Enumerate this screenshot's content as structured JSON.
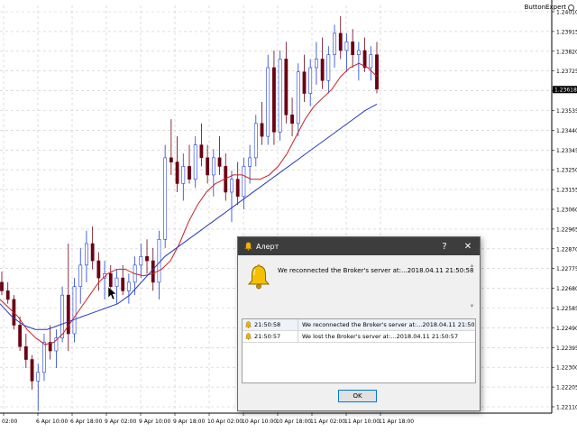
{
  "expert": {
    "label": "ButtonExpert"
  },
  "chart_data": {
    "type": "candlestick",
    "yticks": [
      "1.24010",
      "1.23915",
      "1.23820",
      "1.23725",
      "1.23630",
      "1.23535",
      "1.23440",
      "1.23345",
      "1.23250",
      "1.23155",
      "1.23060",
      "1.22965",
      "1.22870",
      "1.22775",
      "1.22680",
      "1.22585",
      "1.22490",
      "1.22395",
      "1.22300",
      "1.22205",
      "1.22110"
    ],
    "current_price": "1.23618",
    "xticks": [
      "02:00",
      "6 Apr 10:00",
      "6 Apr 18:00",
      "9 Apr 02:00",
      "9 Apr 10:00",
      "9 Apr 18:00",
      "10 Apr 02:00",
      "10 Apr 10:00",
      "10 Apr 18:00",
      "11 Apr 02:00",
      "11 Apr 10:00",
      "11 Apr 18:00"
    ],
    "ylim": [
      1.2211,
      1.2401
    ],
    "colors": {
      "bull": "#1e3fd8",
      "bear": "#6b0013",
      "fast_ma": "#cc1f1f",
      "slow_ma": "#2a3bbf",
      "grid": "#c8c8c8",
      "price_bg": "#000000"
    },
    "candles": [
      [
        1.2272,
        1.2277,
        1.2266,
        1.2268
      ],
      [
        1.2268,
        1.2272,
        1.2262,
        1.2264
      ],
      [
        1.2264,
        1.2266,
        1.225,
        1.2252
      ],
      [
        1.2252,
        1.2256,
        1.224,
        1.2242
      ],
      [
        1.2242,
        1.2248,
        1.2232,
        1.2236
      ],
      [
        1.2236,
        1.2238,
        1.2222,
        1.2226
      ],
      [
        1.2226,
        1.2234,
        1.2212,
        1.223
      ],
      [
        1.223,
        1.2248,
        1.2226,
        1.2244
      ],
      [
        1.2244,
        1.2252,
        1.2236,
        1.224
      ],
      [
        1.224,
        1.225,
        1.2232,
        1.2246
      ],
      [
        1.2246,
        1.227,
        1.2244,
        1.2266
      ],
      [
        1.2266,
        1.229,
        1.224,
        1.2248
      ],
      [
        1.2248,
        1.2274,
        1.2244,
        1.227
      ],
      [
        1.227,
        1.2288,
        1.2262,
        1.228
      ],
      [
        1.228,
        1.2296,
        1.2272,
        1.229
      ],
      [
        1.229,
        1.2298,
        1.2278,
        1.2282
      ],
      [
        1.2282,
        1.2286,
        1.2268,
        1.2274
      ],
      [
        1.2274,
        1.2282,
        1.2264,
        1.2276
      ],
      [
        1.2276,
        1.228,
        1.2266,
        1.227
      ],
      [
        1.227,
        1.2278,
        1.2262,
        1.2274
      ],
      [
        1.2274,
        1.228,
        1.2266,
        1.2268
      ],
      [
        1.2268,
        1.2276,
        1.2262,
        1.2272
      ],
      [
        1.2272,
        1.2284,
        1.2266,
        1.228
      ],
      [
        1.228,
        1.229,
        1.2274,
        1.2284
      ],
      [
        1.2284,
        1.2292,
        1.2276,
        1.2282
      ],
      [
        1.2282,
        1.2288,
        1.2268,
        1.2272
      ],
      [
        1.2272,
        1.2296,
        1.2264,
        1.2292
      ],
      [
        1.2292,
        1.2336,
        1.2288,
        1.233
      ],
      [
        1.233,
        1.2348,
        1.2322,
        1.2328
      ],
      [
        1.2328,
        1.234,
        1.2314,
        1.2318
      ],
      [
        1.2318,
        1.2332,
        1.231,
        1.2326
      ],
      [
        1.2326,
        1.2336,
        1.2318,
        1.232
      ],
      [
        1.232,
        1.234,
        1.2316,
        1.2336
      ],
      [
        1.2336,
        1.2346,
        1.2326,
        1.233
      ],
      [
        1.233,
        1.2336,
        1.2318,
        1.2322
      ],
      [
        1.2322,
        1.2334,
        1.2312,
        1.233
      ],
      [
        1.233,
        1.234,
        1.2322,
        1.2326
      ],
      [
        1.2326,
        1.2332,
        1.231,
        1.2314
      ],
      [
        1.2314,
        1.2324,
        1.23,
        1.232
      ],
      [
        1.232,
        1.2328,
        1.2308,
        1.2312
      ],
      [
        1.2312,
        1.233,
        1.2306,
        1.2326
      ],
      [
        1.2326,
        1.2336,
        1.2318,
        1.233
      ],
      [
        1.233,
        1.235,
        1.2326,
        1.2346
      ],
      [
        1.2346,
        1.2356,
        1.2336,
        1.234
      ],
      [
        1.234,
        1.2378,
        1.2336,
        1.2372
      ],
      [
        1.2372,
        1.238,
        1.2336,
        1.2342
      ],
      [
        1.2342,
        1.238,
        1.2338,
        1.2376
      ],
      [
        1.2376,
        1.2384,
        1.2346,
        1.235
      ],
      [
        1.235,
        1.2358,
        1.234,
        1.2346
      ],
      [
        1.2346,
        1.2374,
        1.234,
        1.237
      ],
      [
        1.237,
        1.2378,
        1.2356,
        1.236
      ],
      [
        1.236,
        1.2376,
        1.2354,
        1.2372
      ],
      [
        1.2372,
        1.2384,
        1.2364,
        1.2376
      ],
      [
        1.2376,
        1.2386,
        1.2362,
        1.2366
      ],
      [
        1.2366,
        1.2382,
        1.236,
        1.2378
      ],
      [
        1.2378,
        1.2392,
        1.2372,
        1.2388
      ],
      [
        1.2388,
        1.2396,
        1.2376,
        1.238
      ],
      [
        1.238,
        1.2388,
        1.237,
        1.2384
      ],
      [
        1.2384,
        1.239,
        1.2372,
        1.2378
      ],
      [
        1.2378,
        1.2384,
        1.2366,
        1.238
      ],
      [
        1.238,
        1.2386,
        1.237,
        1.2372
      ],
      [
        1.2372,
        1.2382,
        1.2366,
        1.2378
      ],
      [
        1.2378,
        1.2384,
        1.236,
        1.2362
      ]
    ],
    "fast_ma": [
      1.2264,
      1.226,
      1.2256,
      1.225,
      1.2246,
      1.2243,
      1.2244,
      1.2248,
      1.2254,
      1.226,
      1.2266,
      1.2272,
      1.2276,
      1.2278,
      1.2278,
      1.2276,
      1.2275,
      1.2276,
      1.2278,
      1.2282,
      1.229,
      1.23,
      1.2308,
      1.2314,
      1.2318,
      1.232,
      1.2322,
      1.2322,
      1.232,
      1.232,
      1.2322,
      1.2326,
      1.2332,
      1.234,
      1.2348,
      1.2354,
      1.2358,
      1.2362,
      1.2368,
      1.2372,
      1.2374,
      1.2372,
      1.2368
    ],
    "slow_ma": [
      1.2262,
      1.2256,
      1.2252,
      1.225,
      1.225,
      1.2252,
      1.2254,
      1.2256,
      1.2258,
      1.226,
      1.2262,
      1.2266,
      1.2272,
      1.2278,
      1.2284,
      1.2288,
      1.2292,
      1.2296,
      1.23,
      1.2304,
      1.2308,
      1.2312,
      1.2316,
      1.232,
      1.2324,
      1.2328,
      1.2332,
      1.2336,
      1.234,
      1.2344,
      1.2348,
      1.2352,
      1.2355
    ]
  },
  "dialog": {
    "title": "Алерт",
    "help_label": "?",
    "close_label": "✕",
    "message": "We reconnected the Broker's server at:...2018.04.11 21:50:58",
    "log": [
      {
        "time": "21:50:58",
        "text": "We reconnected the Broker's server at:...2018.04.11 21:50:58"
      },
      {
        "time": "21:50:57",
        "text": "We lost the Broker's server at:...2018.04.11 21:50:57"
      }
    ],
    "ok_label": "OK",
    "bell_color": "#f0b400"
  }
}
